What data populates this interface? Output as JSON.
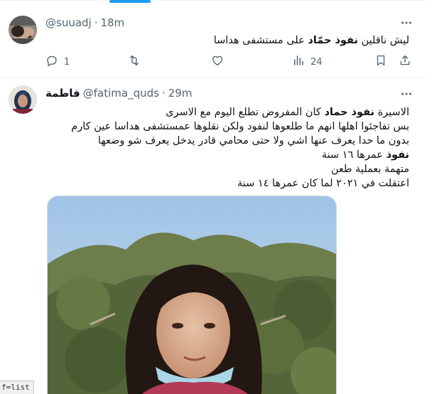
{
  "tweets": [
    {
      "display_name": "",
      "handle": "@suuadj",
      "time": "18m",
      "body": {
        "pre": "ليش ناقلين ",
        "bold": "نفوذ حمّاد",
        "post": " على مستشفى هداسا"
      },
      "actions": {
        "reply_count": "1",
        "retweet_count": "",
        "like_count": "",
        "views_count": "24"
      },
      "icons": [
        "reply-icon",
        "retweet-icon",
        "like-icon",
        "views-icon",
        "bookmark-icon",
        "share-icon",
        "more-icon"
      ]
    },
    {
      "display_name": "فاطمة",
      "handle": "@fatima_quds",
      "time": "29m",
      "body": {
        "l1_pre": "الاسيرة ",
        "l1_bold": "نفوذ حماد",
        "l1_post": " كان المفروض تطلع اليوم مع الاسرى",
        "l2": "بس تفاجئوا اهلها انهم ما طلعوها لنفود ولكن نقلوها عمستشفى هداسا عين كارم",
        "l3": "بدون ما حدا يعرف عنها اشي ولا حتى محامي قادر يدخل يعرف شو وضعها",
        "l4_bold": "نفوذ",
        "l4_post": " عمرها ١٦ سنة",
        "l5": "متهمة بعملية طعن",
        "l6": "اعتقلت في ٢٠٢١ لما كان عمرها ١٤ سنة"
      }
    }
  ],
  "corner_tag": "f=list",
  "colors": {
    "accent": "#1d9bf0",
    "text": "#0f1419",
    "muted": "#536471",
    "border": "#eff3f4"
  }
}
